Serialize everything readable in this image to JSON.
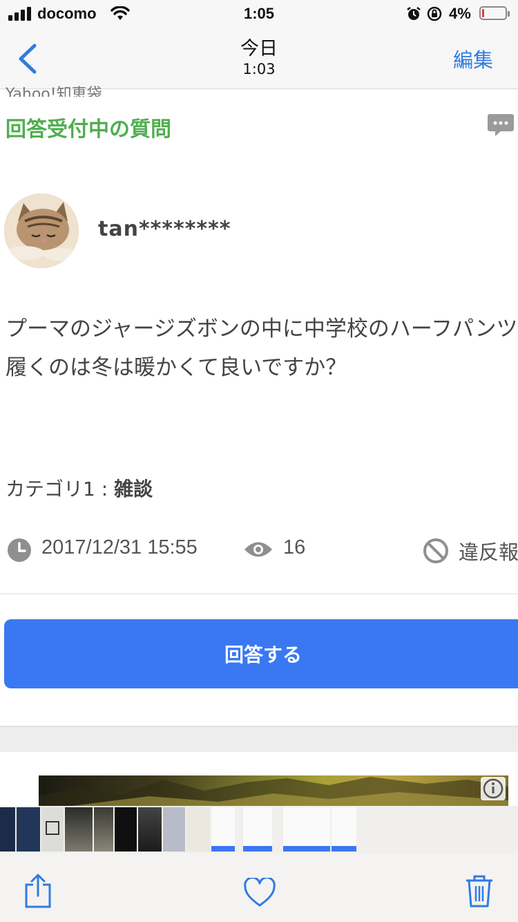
{
  "status_bar": {
    "carrier": "docomo",
    "time": "1:05",
    "battery_percent": "4%",
    "battery_level": 0.04
  },
  "nav": {
    "back_icon": "chevron-left-icon",
    "title": "今日",
    "subtitle": "1:03",
    "edit_label": "編集",
    "accent_color": "#2f7be2"
  },
  "page": {
    "brand": "Yahoo!知恵袋",
    "status_heading": "回答受付中の質問",
    "status_color": "#4fae4f",
    "comment_icon": "comment-bubble-icon"
  },
  "question": {
    "username": "tan********",
    "text": "プーマのジャージズボンの中に中学校のハーフパンツ履くのは冬は暖かくて良いですか？",
    "category_label": "カテゴリ1 : ",
    "category_value": "雑談",
    "date": "2017/12/31 15:55",
    "views": "16",
    "report_label": "違反報告"
  },
  "answer_button": {
    "label": "回答する",
    "color": "#3a78f2"
  },
  "toolbar": {
    "share_icon": "share-icon",
    "favorite_icon": "heart-icon",
    "delete_icon": "trash-icon"
  }
}
